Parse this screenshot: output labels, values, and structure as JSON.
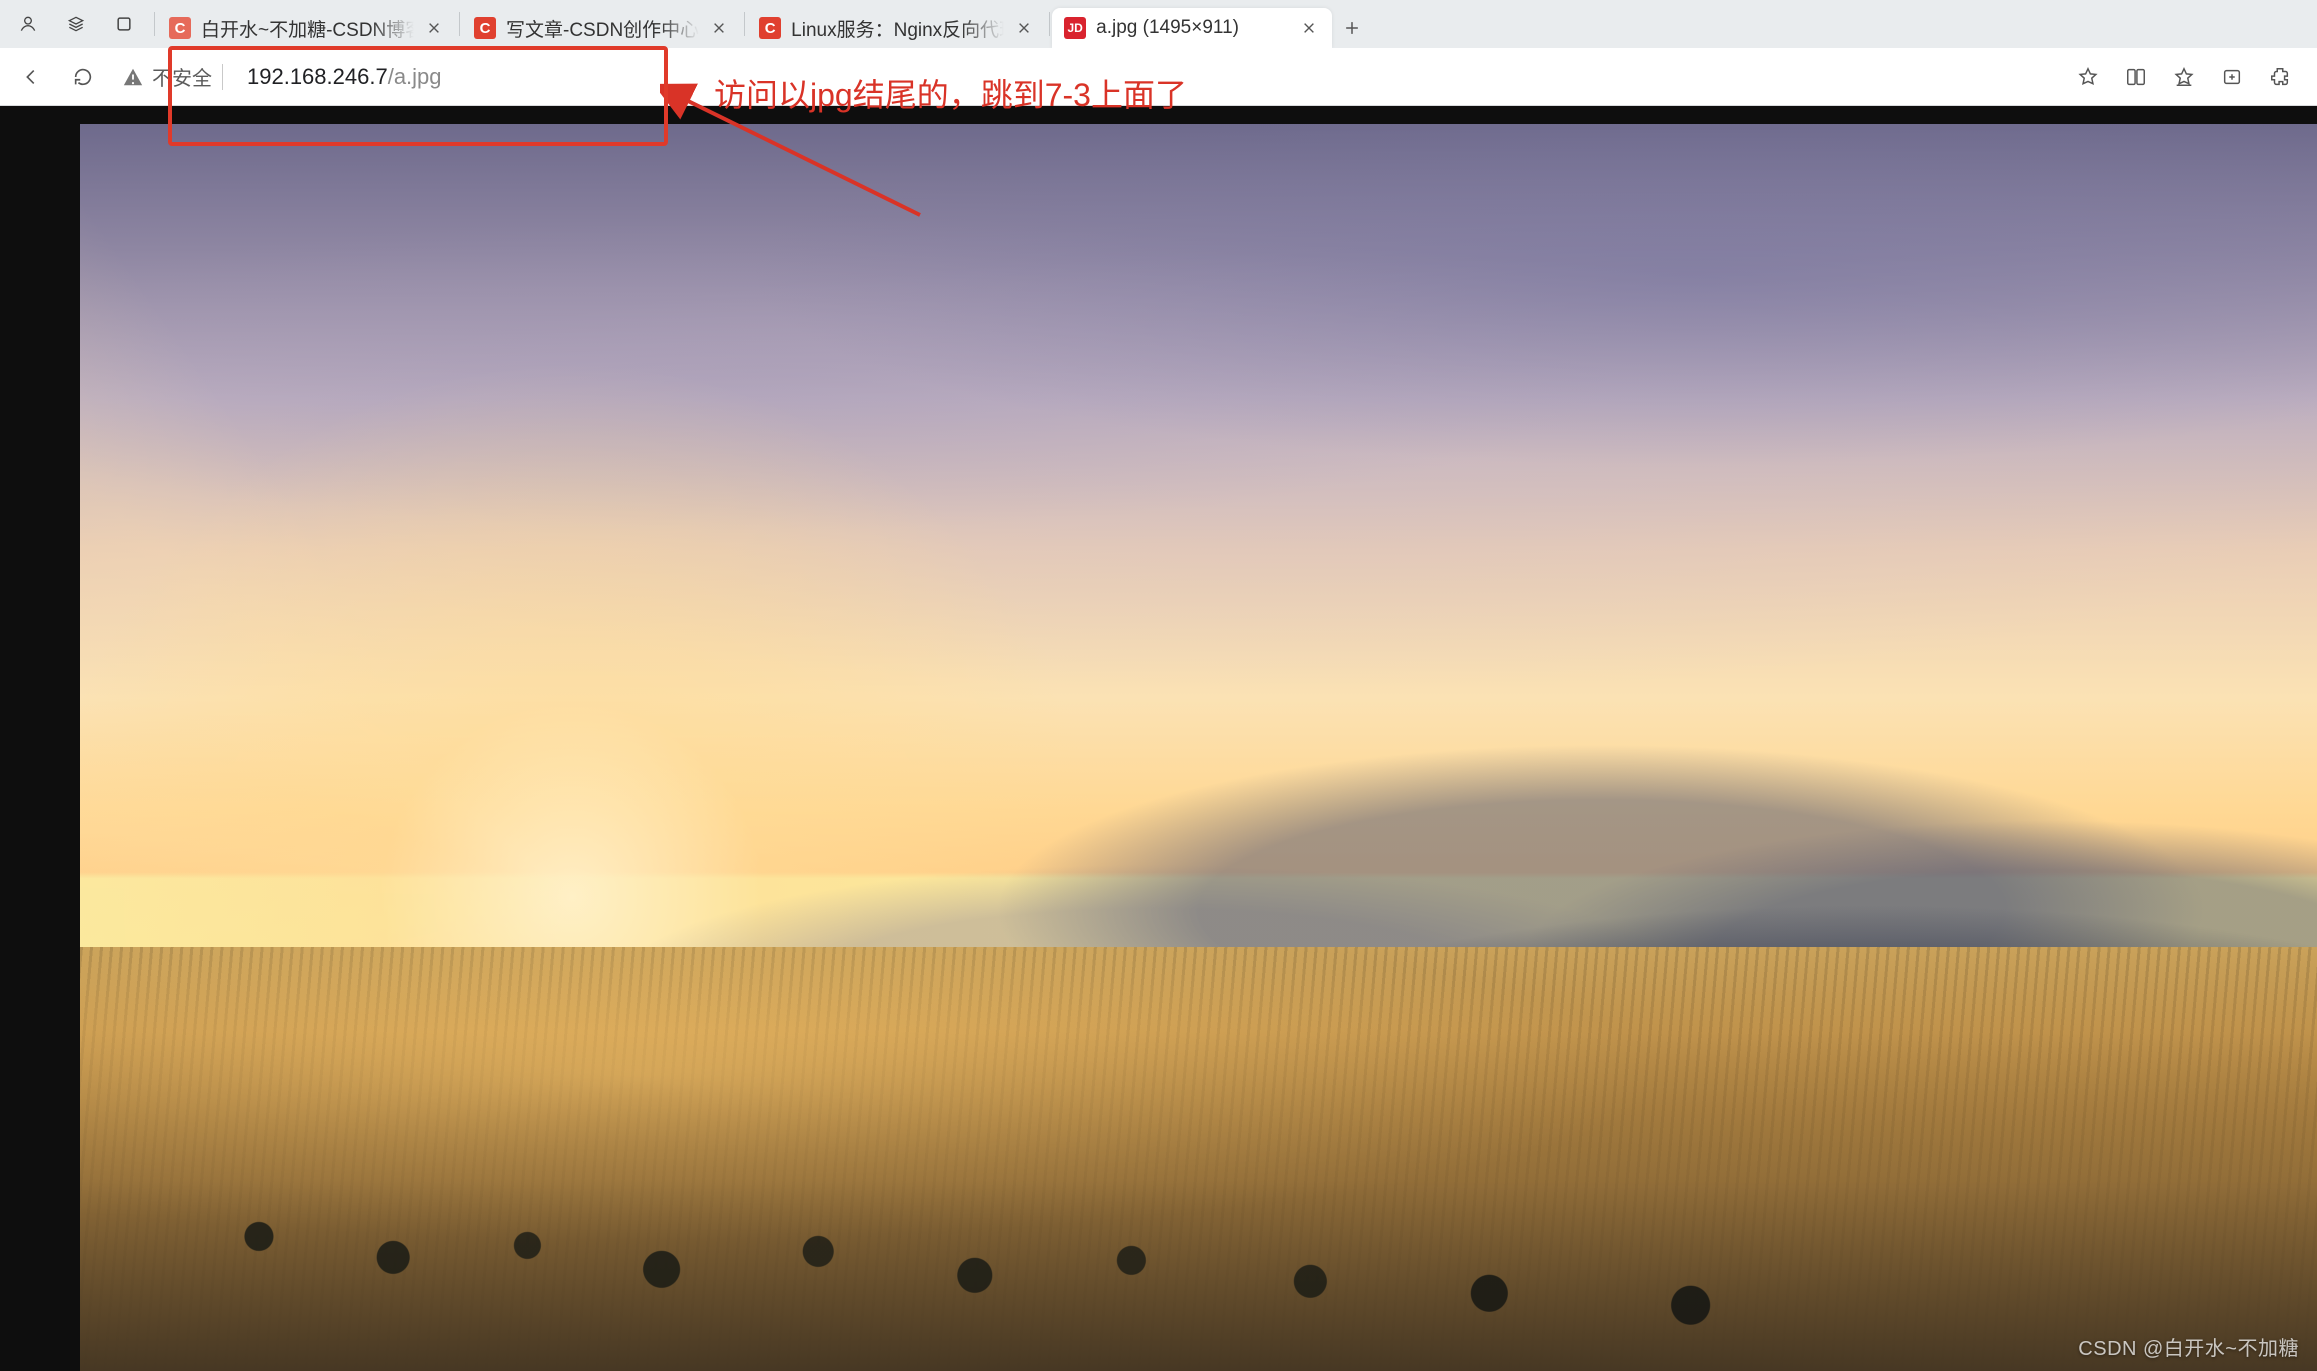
{
  "tabs": [
    {
      "favicon_letter": "C",
      "favicon_bg": "#e66a5a",
      "title": "白开水~不加糖-CSDN博客",
      "active": false,
      "closeable": true
    },
    {
      "favicon_letter": "C",
      "favicon_bg": "#e0402f",
      "title": "写文章-CSDN创作中心",
      "active": false,
      "closeable": true
    },
    {
      "favicon_letter": "C",
      "favicon_bg": "#e0402f",
      "title": "Linux服务：Nginx反向代理与负",
      "active": false,
      "closeable": true
    },
    {
      "favicon_letter": "JD",
      "favicon_bg": "#d9232e",
      "title": "a.jpg (1495×911)",
      "active": true,
      "closeable": true
    }
  ],
  "addressbar": {
    "security_label": "不安全",
    "host": "192.168.246.7",
    "path": "/a.jpg"
  },
  "annotation": {
    "text": "访问以jpg结尾的，跳到7-3上面了"
  },
  "watermark": "CSDN @白开水~不加糖",
  "colors": {
    "annotation_red": "#d93327",
    "tabstrip_bg": "#e9ecee"
  }
}
